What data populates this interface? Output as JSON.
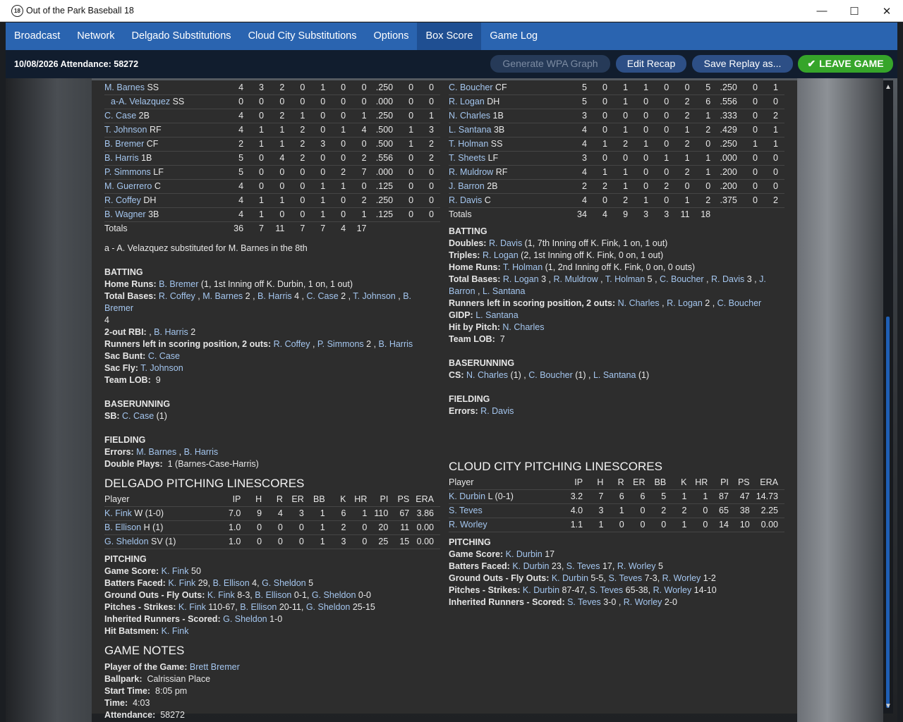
{
  "window": {
    "title": "Out of the Park Baseball 18",
    "app_icon_text": "18"
  },
  "menu": {
    "items": [
      "Broadcast",
      "Network",
      "Delgado Substitutions",
      "Cloud City Substitutions",
      "Options",
      "Box Score",
      "Game Log"
    ],
    "active": "Box Score"
  },
  "toolbar": {
    "info": "10/08/2026 Attendance: 58272",
    "wpa": "Generate WPA Graph",
    "recap": "Edit Recap",
    "replay": "Save Replay as...",
    "leave": "LEAVE GAME"
  },
  "delgado": {
    "batters": [
      {
        "name": "M. Barnes",
        "pos": "SS",
        "sub": false,
        "stats": [
          "4",
          "3",
          "2",
          "0",
          "1",
          "0",
          "0",
          ".250",
          "0",
          "0"
        ]
      },
      {
        "name": "a-A. Velazquez",
        "pos": "SS",
        "sub": true,
        "stats": [
          "0",
          "0",
          "0",
          "0",
          "0",
          "0",
          "0",
          ".000",
          "0",
          "0"
        ]
      },
      {
        "name": "C. Case",
        "pos": "2B",
        "sub": false,
        "stats": [
          "4",
          "0",
          "2",
          "1",
          "0",
          "0",
          "1",
          ".250",
          "0",
          "1"
        ]
      },
      {
        "name": "T. Johnson",
        "pos": "RF",
        "sub": false,
        "stats": [
          "4",
          "1",
          "1",
          "2",
          "0",
          "1",
          "4",
          ".500",
          "1",
          "3"
        ]
      },
      {
        "name": "B. Bremer",
        "pos": "CF",
        "sub": false,
        "stats": [
          "2",
          "1",
          "1",
          "2",
          "3",
          "0",
          "0",
          ".500",
          "1",
          "2"
        ]
      },
      {
        "name": "B. Harris",
        "pos": "1B",
        "sub": false,
        "stats": [
          "5",
          "0",
          "4",
          "2",
          "0",
          "0",
          "2",
          ".556",
          "0",
          "2"
        ]
      },
      {
        "name": "P. Simmons",
        "pos": "LF",
        "sub": false,
        "stats": [
          "5",
          "0",
          "0",
          "0",
          "0",
          "2",
          "7",
          ".000",
          "0",
          "0"
        ]
      },
      {
        "name": "M. Guerrero",
        "pos": "C",
        "sub": false,
        "stats": [
          "4",
          "0",
          "0",
          "0",
          "1",
          "1",
          "0",
          ".125",
          "0",
          "0"
        ]
      },
      {
        "name": "R. Coffey",
        "pos": "DH",
        "sub": false,
        "stats": [
          "4",
          "1",
          "1",
          "0",
          "1",
          "0",
          "2",
          ".250",
          "0",
          "0"
        ]
      },
      {
        "name": "B. Wagner",
        "pos": "3B",
        "sub": false,
        "stats": [
          "4",
          "1",
          "0",
          "0",
          "1",
          "0",
          "1",
          ".125",
          "0",
          "0"
        ]
      }
    ],
    "totals": {
      "label": "Totals",
      "stats": [
        "36",
        "7",
        "11",
        "7",
        "7",
        "4",
        "17",
        "",
        "",
        ""
      ]
    },
    "sub_note": "a - A. Velazquez substituted for M. Barnes in the 8th",
    "batting_title": "BATTING",
    "home_runs_label": "Home Runs:",
    "home_runs": {
      "player": "B. Bremer",
      "detail": " (1, 1st Inning off K. Durbin, 1 on, 1 out)"
    },
    "total_bases_label": "Total Bases:",
    "total_bases": [
      {
        "p": "R. Coffey",
        "n": ""
      },
      {
        "p": "M. Barnes",
        "n": "2"
      },
      {
        "p": "B. Harris",
        "n": "4"
      },
      {
        "p": "C. Case",
        "n": "2"
      },
      {
        "p": "T. Johnson",
        "n": ""
      },
      {
        "p": "B. Bremer",
        "n": ""
      }
    ],
    "total_bases_tail": "4",
    "two_out_rbi_label": "2-out RBI:",
    "two_out_rbi": {
      "prefix": " ,",
      "player": "B. Harris",
      "n": "2"
    },
    "rlisp_label": "Runners left in scoring position, 2 outs:",
    "rlisp": [
      {
        "p": "R. Coffey",
        "n": ""
      },
      {
        "p": "P. Simmons",
        "n": "2"
      },
      {
        "p": "B. Harris",
        "n": ""
      }
    ],
    "sac_bunt_label": "Sac Bunt:",
    "sac_bunt": "C. Case",
    "sac_fly_label": "Sac Fly:",
    "sac_fly": "T. Johnson",
    "team_lob_label": "Team LOB:",
    "team_lob": "9",
    "baserunning_title": "BASERUNNING",
    "sb_label": "SB:",
    "sb_player": "C. Case",
    "sb_n": " (1)",
    "fielding_title": "FIELDING",
    "errors_label": "Errors:",
    "errors": [
      "M. Barnes",
      "B. Harris"
    ],
    "dp_label": "Double Plays:",
    "dp": "1 (Barnes-Case-Harris)",
    "pitching_title": "DELGADO PITCHING LINESCORES",
    "pitchers": [
      {
        "name": "K. Fink",
        "dec": " W (1-0)",
        "stats": [
          "7.0",
          "9",
          "4",
          "3",
          "1",
          "6",
          "1",
          "110",
          "67",
          "3.86"
        ]
      },
      {
        "name": "B. Ellison",
        "dec": " H (1)",
        "stats": [
          "1.0",
          "0",
          "0",
          "0",
          "1",
          "2",
          "0",
          "20",
          "11",
          "0.00"
        ]
      },
      {
        "name": "G. Sheldon",
        "dec": " SV (1)",
        "stats": [
          "1.0",
          "0",
          "0",
          "0",
          "1",
          "3",
          "0",
          "25",
          "15",
          "0.00"
        ]
      }
    ],
    "pitching_sub": "PITCHING",
    "game_score_label": "Game Score:",
    "game_score": [
      {
        "p": "K. Fink",
        "n": "50"
      }
    ],
    "bf_label": "Batters Faced:",
    "bf": [
      {
        "p": "K. Fink",
        "n": "29"
      },
      {
        "p": "B. Ellison",
        "n": "4"
      },
      {
        "p": "G. Sheldon",
        "n": "5"
      }
    ],
    "gofo_label": "Ground Outs - Fly Outs:",
    "gofo": [
      {
        "p": "K. Fink",
        "n": "8-3"
      },
      {
        "p": "B. Ellison",
        "n": "0-1"
      },
      {
        "p": "G. Sheldon",
        "n": "0-0"
      }
    ],
    "ps_label": "Pitches - Strikes:",
    "ps": [
      {
        "p": "K. Fink",
        "n": "110-67"
      },
      {
        "p": "B. Ellison",
        "n": "20-11"
      },
      {
        "p": "G. Sheldon",
        "n": "25-15"
      }
    ],
    "ir_label": "Inherited Runners - Scored:",
    "ir": [
      {
        "p": "G. Sheldon",
        "n": "1-0"
      }
    ],
    "hb_label": "Hit Batsmen:",
    "hb": "K. Fink"
  },
  "cloud": {
    "batters": [
      {
        "name": "C. Boucher",
        "pos": "CF",
        "stats": [
          "5",
          "0",
          "1",
          "1",
          "0",
          "0",
          "5",
          ".250",
          "0",
          "1"
        ]
      },
      {
        "name": "R. Logan",
        "pos": "DH",
        "stats": [
          "5",
          "0",
          "1",
          "0",
          "0",
          "2",
          "6",
          ".556",
          "0",
          "0"
        ]
      },
      {
        "name": "N. Charles",
        "pos": "1B",
        "stats": [
          "3",
          "0",
          "0",
          "0",
          "0",
          "2",
          "1",
          ".333",
          "0",
          "2"
        ]
      },
      {
        "name": "L. Santana",
        "pos": "3B",
        "stats": [
          "4",
          "0",
          "1",
          "0",
          "0",
          "1",
          "2",
          ".429",
          "0",
          "1"
        ]
      },
      {
        "name": "T. Holman",
        "pos": "SS",
        "stats": [
          "4",
          "1",
          "2",
          "1",
          "0",
          "2",
          "0",
          ".250",
          "1",
          "1"
        ]
      },
      {
        "name": "T. Sheets",
        "pos": "LF",
        "stats": [
          "3",
          "0",
          "0",
          "0",
          "1",
          "1",
          "1",
          ".000",
          "0",
          "0"
        ]
      },
      {
        "name": "R. Muldrow",
        "pos": "RF",
        "stats": [
          "4",
          "1",
          "1",
          "0",
          "0",
          "2",
          "1",
          ".200",
          "0",
          "0"
        ]
      },
      {
        "name": "J. Barron",
        "pos": "2B",
        "stats": [
          "2",
          "2",
          "1",
          "0",
          "2",
          "0",
          "0",
          ".200",
          "0",
          "0"
        ]
      },
      {
        "name": "R. Davis",
        "pos": "C",
        "stats": [
          "4",
          "0",
          "2",
          "1",
          "0",
          "1",
          "2",
          ".375",
          "0",
          "2"
        ]
      }
    ],
    "totals": {
      "label": "Totals",
      "stats": [
        "34",
        "4",
        "9",
        "3",
        "3",
        "11",
        "18",
        "",
        "",
        ""
      ]
    },
    "batting_title": "BATTING",
    "doubles_label": "Doubles:",
    "doubles": {
      "player": "R. Davis",
      "detail": " (1, 7th Inning off K. Fink, 1 on, 1 out)"
    },
    "triples_label": "Triples:",
    "triples": {
      "player": "R. Logan",
      "detail": " (2, 1st Inning off K. Fink, 0 on, 1 out)"
    },
    "hr_label": "Home Runs:",
    "hr": {
      "player": "T. Holman",
      "detail": " (1, 2nd Inning off K. Fink, 0 on, 0 outs)"
    },
    "tb_label": "Total Bases:",
    "tb": [
      {
        "p": "R. Logan",
        "n": "3"
      },
      {
        "p": "R. Muldrow",
        "n": ""
      },
      {
        "p": "T. Holman",
        "n": "5"
      },
      {
        "p": "C. Boucher",
        "n": ""
      },
      {
        "p": "R. Davis",
        "n": "3"
      }
    ],
    "tb_wrap1": "J.",
    "tb_wrap2": "Barron",
    "tb_last": "L. Santana",
    "rlisp_label": "Runners left in scoring position, 2 outs:",
    "rlisp": [
      {
        "p": "N. Charles",
        "n": ""
      },
      {
        "p": "R. Logan",
        "n": "2"
      },
      {
        "p": "C. Boucher",
        "n": ""
      }
    ],
    "gidp_label": "GIDP:",
    "gidp": "L. Santana",
    "hbp_label": "Hit by Pitch:",
    "hbp": "N. Charles",
    "team_lob_label": "Team LOB:",
    "team_lob": "7",
    "baserunning_title": "BASERUNNING",
    "cs_label": "CS:",
    "cs": [
      {
        "p": "N. Charles",
        "n": "(1)"
      },
      {
        "p": "C. Boucher",
        "n": "(1)"
      },
      {
        "p": "L. Santana",
        "n": "(1)"
      }
    ],
    "fielding_title": "FIELDING",
    "errors_label": "Errors:",
    "errors": "R. Davis",
    "pitching_title": "CLOUD CITY PITCHING LINESCORES",
    "pitchers": [
      {
        "name": "K. Durbin",
        "dec": " L (0-1)",
        "stats": [
          "3.2",
          "7",
          "6",
          "6",
          "5",
          "1",
          "1",
          "87",
          "47",
          "14.73"
        ]
      },
      {
        "name": "S. Teves",
        "dec": "",
        "stats": [
          "4.0",
          "3",
          "1",
          "0",
          "2",
          "2",
          "0",
          "65",
          "38",
          "2.25"
        ]
      },
      {
        "name": "R. Worley",
        "dec": "",
        "stats": [
          "1.1",
          "1",
          "0",
          "0",
          "0",
          "1",
          "0",
          "14",
          "10",
          "0.00"
        ]
      }
    ],
    "pitching_sub": "PITCHING",
    "game_score_label": "Game Score:",
    "game_score": [
      {
        "p": "K. Durbin",
        "n": "17"
      }
    ],
    "bf_label": "Batters Faced:",
    "bf": [
      {
        "p": "K. Durbin",
        "n": "23"
      },
      {
        "p": "S. Teves",
        "n": "17"
      },
      {
        "p": "R. Worley",
        "n": "5"
      }
    ],
    "gofo_label": "Ground Outs - Fly Outs:",
    "gofo": [
      {
        "p": "K. Durbin",
        "n": "5-5"
      },
      {
        "p": "S. Teves",
        "n": "7-3"
      },
      {
        "p": "R. Worley",
        "n": "1-2"
      }
    ],
    "ps_label": "Pitches - Strikes:",
    "ps": [
      {
        "p": "K. Durbin",
        "n": "87-47"
      },
      {
        "p": "S. Teves",
        "n": "65-38"
      },
      {
        "p": "R. Worley",
        "n": "14-10"
      }
    ],
    "ir_label": "Inherited Runners - Scored:",
    "ir": [
      {
        "p": "S. Teves",
        "n": "3-0"
      },
      {
        "p": "R. Worley",
        "n": "2-0"
      }
    ]
  },
  "pitch_headers": [
    "Player",
    "IP",
    "H",
    "R",
    "ER",
    "BB",
    "K",
    "HR",
    "PI",
    "PS",
    "ERA"
  ],
  "notes": {
    "title": "GAME NOTES",
    "potg_label": "Player of the Game:",
    "potg": "Brett Bremer",
    "ballpark_label": "Ballpark:",
    "ballpark": "Calrissian Place",
    "start_label": "Start Time:",
    "start": "8:05 pm",
    "time_label": "Time:",
    "time": "4:03",
    "att_label": "Attendance:",
    "att": "58272"
  },
  "colors": {
    "menu_bg": "#2a64b0",
    "toolbar_bg": "#111d2e",
    "panel_bg": "#2d2d2d",
    "link": "#a4c6ef",
    "leave_btn": "#36a52a",
    "button": "#2d4f86"
  }
}
